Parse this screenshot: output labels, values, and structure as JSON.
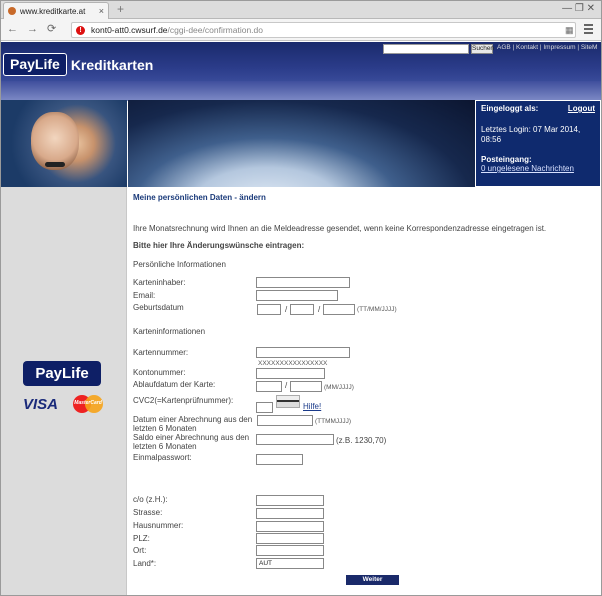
{
  "browser": {
    "tab_title": "www.kreditkarte.at",
    "tab_close": "×",
    "new_tab": "+",
    "window_controls": "— ❐ ✕",
    "url_host": "kont0-att0.cwsurf.de",
    "url_path": "/cggi-dee/confirmation.do",
    "back": "←",
    "forward": "→",
    "reload": "⟳",
    "page_icon": "▦"
  },
  "header": {
    "logo_paylife": "PayLife",
    "logo_kreditkarten": "Kreditkarten",
    "search_button": "Suchen",
    "links": "AGB | Kontakt | Impressum | SiteM"
  },
  "login_panel": {
    "label": "Eingeloggt als:",
    "logout": "Logout",
    "last_login": "Letztes Login: 07 Mar 2014, 08:56",
    "inbox": "Posteingang:",
    "messages": "0 ungelesene Nachrichten"
  },
  "sidebar": {
    "paylife": "PayLife",
    "visa": "VISA",
    "mastercard": "MasterCard"
  },
  "form": {
    "title": "Meine persönlichen Daten - ändern",
    "intro": "Ihre Monatsrechnung wird Ihnen an die Meldeadresse gesendet, wenn keine Korrespondenzadresse eingetragen ist.",
    "instruction": "Bitte hier Ihre Änderungswünsche eintragen:",
    "section_personal": "Persönliche Informationen",
    "karteninhaber": "Karteninhaber:",
    "email": "Email:",
    "geburtsdatum": "Geburtsdatum",
    "date_sep": "/",
    "date_hint": "(TT/MM/JJJJ)",
    "section_card": "Karteninformationen",
    "kartennummer": "Kartennummer:",
    "masked_number": "XXXXXXXXXXXXXXXX",
    "kontonummer": "Kontonummer:",
    "ablaufdatum": "Ablaufdatum der Karte:",
    "expiry_hint": "(MM/JJJJ)",
    "cvc": "CVC2(=Kartenprüfnummer):",
    "hilfe": "Hilfe!",
    "abrechnung_datum": "Datum einer Abrechnung aus den letzten 6 Monaten",
    "abrechnung_hint": "(TTMMJJJJ)",
    "saldo": "Saldo einer Abrechnung aus den letzten 6 Monaten",
    "saldo_hint": "(z.B. 1230,70)",
    "einmalpasswort": "Einmalpasswort:",
    "co": "c/o (z.H.):",
    "strasse": "Strasse:",
    "hausnummer": "Hausnummer:",
    "plz": "PLZ:",
    "ort": "Ort:",
    "land": "Land*:",
    "land_value": "AUT",
    "weiter": "Weiter"
  }
}
